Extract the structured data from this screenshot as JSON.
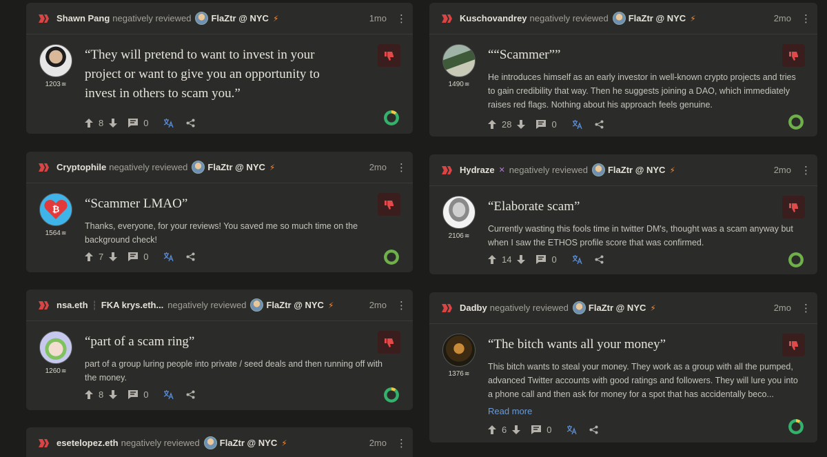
{
  "common": {
    "verb": "negatively reviewed",
    "target": "FlaZtr @ NYC",
    "read_more": "Read more"
  },
  "reviews": [
    {
      "author": "Shawn Pang",
      "time": "1mo",
      "score": "1203",
      "title": "“They will pretend to want to invest in your project or want to give you an opportunity to invest in others to scam you.”",
      "body": "",
      "upvotes": "8",
      "comments": "0"
    },
    {
      "author": "Kuschovandrey",
      "time": "2mo",
      "score": "1490",
      "title": "““Scammer””",
      "body": "He introduces himself as an early investor in well-known crypto projects and tries to gain credibility that way. Then he suggests joining a DAO, which immediately raises red flags. Nothing about his approach feels genuine.",
      "upvotes": "28",
      "comments": "0"
    },
    {
      "author": "Cryptophile",
      "time": "2mo",
      "score": "1564",
      "title": "“Scammer LMAO”",
      "body": "Thanks, everyone, for your reviews! You saved me so much time on the background check!",
      "upvotes": "7",
      "comments": "0"
    },
    {
      "author": "Hydraze",
      "time": "2mo",
      "score": "2106",
      "title": "“Elaborate scam”",
      "body": "Currently wasting this fools time in twitter DM's, thought was a scam anyway but when I saw the ETHOS profile score that was confirmed.",
      "upvotes": "14",
      "comments": "0"
    },
    {
      "author": "nsa.eth",
      "alias": "FKA krys.eth...",
      "time": "2mo",
      "score": "1260",
      "title": "“part of a scam ring”",
      "body": "part of a group luring people into private / seed deals and then running off with the money.",
      "upvotes": "8",
      "comments": "0"
    },
    {
      "author": "Dadby",
      "time": "2mo",
      "score": "1376",
      "title": "“The bitch wants all your money”",
      "body": "This bitch wants to steal your money. They work as a group with all the pumped, advanced Twitter accounts with good ratings and followers. They will lure you into a phone call and then ask for money for a spot that has accidentally beco...",
      "upvotes": "6",
      "comments": "0"
    },
    {
      "author": "esetelopez.eth",
      "time": "2mo"
    }
  ],
  "colors": {
    "page_bg": "#1c1c1a",
    "card_bg": "#2b2b29",
    "negative_badge_bg": "#3a1e1e",
    "negative_red": "#e04a4a",
    "translate_blue": "#5b8fd8",
    "link_blue": "#6b9ad6",
    "bolt_orange": "#f08a3c"
  },
  "icons": {
    "logo": "ethos-logo-icon",
    "upvote": "arrow-up-icon",
    "downvote": "arrow-down-icon",
    "comment": "comment-icon",
    "translate": "translate-icon",
    "share": "share-icon",
    "thumbs_down": "thumbs-down-icon",
    "more": "kebab-menu-icon",
    "ring": "score-ring-icon"
  }
}
